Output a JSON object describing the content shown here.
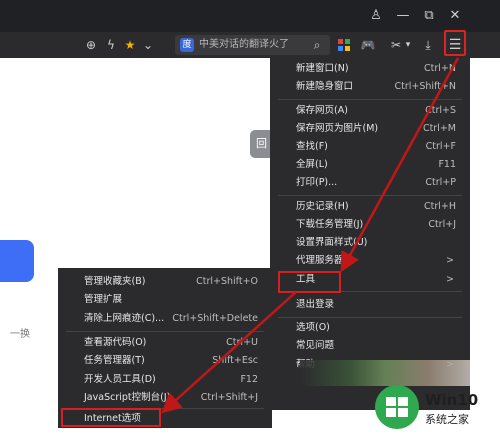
{
  "window": {
    "title_buttons": [
      "♙",
      "—",
      "⧉",
      "✕"
    ]
  },
  "toolbar": {
    "search_text": "中美对话的翻译火了",
    "baidu_label": "度"
  },
  "page": {
    "left_text": "一换",
    "grey_tab_text": "回"
  },
  "main_menu": {
    "items": [
      {
        "label": "新建窗口(N)",
        "shortcut": "Ctrl+N"
      },
      {
        "label": "新建隐身窗口",
        "shortcut": "Ctrl+Shift+N"
      },
      {
        "label": "保存网页(A)",
        "shortcut": "Ctrl+S"
      },
      {
        "label": "保存网页为图片(M)",
        "shortcut": "Ctrl+M"
      },
      {
        "label": "查找(F)",
        "shortcut": "Ctrl+F"
      },
      {
        "label": "全屏(L)",
        "shortcut": "F11"
      },
      {
        "label": "打印(P)...",
        "shortcut": "Ctrl+P"
      },
      {
        "label": "历史记录(H)",
        "shortcut": "Ctrl+H"
      },
      {
        "label": "下载任务管理(J)",
        "shortcut": "Ctrl+J"
      },
      {
        "label": "设置界面样式(U)",
        "shortcut": ""
      },
      {
        "label": "代理服务器",
        "shortcut": ">"
      },
      {
        "label": "工具",
        "shortcut": ">"
      },
      {
        "label": "退出登录",
        "shortcut": ""
      },
      {
        "label": "选项(O)",
        "shortcut": ""
      },
      {
        "label": "常见问题",
        "shortcut": ""
      },
      {
        "label": "帮助",
        "shortcut": ">"
      }
    ]
  },
  "tools_menu": {
    "items": [
      {
        "label": "管理收藏夹(B)",
        "shortcut": "Ctrl+Shift+O"
      },
      {
        "label": "管理扩展",
        "shortcut": ""
      },
      {
        "label": "清除上网痕迹(C)...",
        "shortcut": "Ctrl+Shift+Delete"
      },
      {
        "label": "查看源代码(O)",
        "shortcut": "Ctrl+U"
      },
      {
        "label": "任务管理器(T)",
        "shortcut": "Shift+Esc"
      },
      {
        "label": "开发人员工具(D)",
        "shortcut": "F12"
      },
      {
        "label": "JavaScript控制台(J)",
        "shortcut": "Ctrl+Shift+J"
      },
      {
        "label": "Internet选项",
        "shortcut": ""
      }
    ]
  },
  "watermark": {
    "title": "Win10",
    "subtitle": "系统之家"
  },
  "colors": {
    "highlight": "#d42020",
    "menu_bg": "#2b2b2d",
    "accent_blue": "#3d6ef5"
  }
}
